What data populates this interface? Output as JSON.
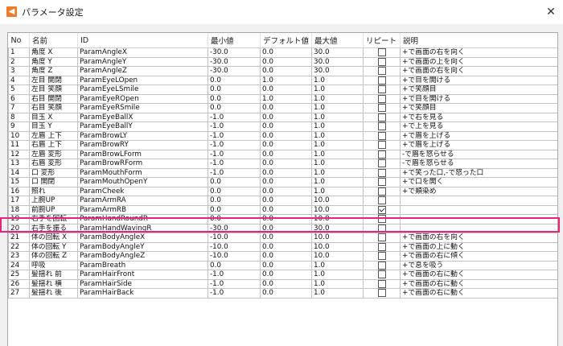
{
  "window": {
    "title": "パラメータ設定",
    "close_glyph": "✕"
  },
  "table": {
    "headers": [
      "No",
      "名前",
      "ID",
      "最小値",
      "デフォルト値",
      "最大値",
      "リピート",
      "説明"
    ],
    "rows": [
      {
        "no": "1",
        "name": "角度 X",
        "id": "ParamAngleX",
        "min": "-30.0",
        "def": "0.0",
        "max": "30.0",
        "repeat": false,
        "desc": "+で画面の右を向く"
      },
      {
        "no": "2",
        "name": "角度 Y",
        "id": "ParamAngleY",
        "min": "-30.0",
        "def": "0.0",
        "max": "30.0",
        "repeat": false,
        "desc": "+で画面の上を向く"
      },
      {
        "no": "3",
        "name": "角度 Z",
        "id": "ParamAngleZ",
        "min": "-30.0",
        "def": "0.0",
        "max": "30.0",
        "repeat": false,
        "desc": "+で画面の右を向く"
      },
      {
        "no": "4",
        "name": "左目 開閉",
        "id": "ParamEyeLOpen",
        "min": "0.0",
        "def": "1.0",
        "max": "1.0",
        "repeat": false,
        "desc": "+で目を開ける"
      },
      {
        "no": "5",
        "name": "左目 笑顔",
        "id": "ParamEyeLSmile",
        "min": "0.0",
        "def": "0.0",
        "max": "1.0",
        "repeat": false,
        "desc": "+で笑顔目"
      },
      {
        "no": "6",
        "name": "右目 開閉",
        "id": "ParamEyeROpen",
        "min": "0.0",
        "def": "1.0",
        "max": "1.0",
        "repeat": false,
        "desc": "+で目を開ける"
      },
      {
        "no": "7",
        "name": "右目 笑顔",
        "id": "ParamEyeRSmile",
        "min": "0.0",
        "def": "0.0",
        "max": "1.0",
        "repeat": false,
        "desc": "+で笑顔目"
      },
      {
        "no": "8",
        "name": "目玉 X",
        "id": "ParamEyeBallX",
        "min": "-1.0",
        "def": "0.0",
        "max": "1.0",
        "repeat": false,
        "desc": "+で右を見る"
      },
      {
        "no": "9",
        "name": "目玉 Y",
        "id": "ParamEyeBallY",
        "min": "-1.0",
        "def": "0.0",
        "max": "1.0",
        "repeat": false,
        "desc": "+で上を見る"
      },
      {
        "no": "10",
        "name": "左眉 上下",
        "id": "ParamBrowLY",
        "min": "-1.0",
        "def": "0.0",
        "max": "1.0",
        "repeat": false,
        "desc": "+で眉を上げる"
      },
      {
        "no": "11",
        "name": "右眉 上下",
        "id": "ParamBrowRY",
        "min": "-1.0",
        "def": "0.0",
        "max": "1.0",
        "repeat": false,
        "desc": "+で眉を上げる"
      },
      {
        "no": "12",
        "name": "左眉 変形",
        "id": "ParamBrowLForm",
        "min": "-1.0",
        "def": "0.0",
        "max": "1.0",
        "repeat": false,
        "desc": "-で眉を怒らせる"
      },
      {
        "no": "13",
        "name": "右眉 変形",
        "id": "ParamBrowRForm",
        "min": "-1.0",
        "def": "0.0",
        "max": "1.0",
        "repeat": false,
        "desc": "-で眉を怒らせる"
      },
      {
        "no": "14",
        "name": "口 変形",
        "id": "ParamMouthForm",
        "min": "-1.0",
        "def": "0.0",
        "max": "1.0",
        "repeat": false,
        "desc": "+で笑った口,-で怒った口"
      },
      {
        "no": "15",
        "name": "口 開閉",
        "id": "ParamMouthOpenY",
        "min": "0.0",
        "def": "0.0",
        "max": "1.0",
        "repeat": false,
        "desc": "+で口を開く"
      },
      {
        "no": "16",
        "name": "照れ",
        "id": "ParamCheek",
        "min": "0.0",
        "def": "0.0",
        "max": "1.0",
        "repeat": false,
        "desc": "+で頬染め"
      },
      {
        "no": "17",
        "name": "上腕UP",
        "id": "ParamArmRA",
        "min": "0.0",
        "def": "0.0",
        "max": "10.0",
        "repeat": false,
        "desc": ""
      },
      {
        "no": "18",
        "name": "前腕UP",
        "id": "ParamArmRB",
        "min": "0.0",
        "def": "0.0",
        "max": "10.0",
        "repeat": true,
        "desc": ""
      },
      {
        "no": "19",
        "name": "右手を回転",
        "id": "ParamHandRoundR",
        "min": "0.0",
        "def": "0.0",
        "max": "10.0",
        "repeat": false,
        "desc": ""
      },
      {
        "no": "20",
        "name": "右手を振る",
        "id": "ParamHandWavingR",
        "min": "-30.0",
        "def": "0.0",
        "max": "30.0",
        "repeat": false,
        "desc": ""
      },
      {
        "no": "21",
        "name": "体の回転 X",
        "id": "ParamBodyAngleX",
        "min": "-10.0",
        "def": "0.0",
        "max": "10.0",
        "repeat": false,
        "desc": "+で画面の右を向く"
      },
      {
        "no": "22",
        "name": "体の回転 Y",
        "id": "ParamBodyAngleY",
        "min": "-10.0",
        "def": "0.0",
        "max": "10.0",
        "repeat": false,
        "desc": "+で画面の上に動く"
      },
      {
        "no": "23",
        "name": "体の回転 Z",
        "id": "ParamBodyAngleZ",
        "min": "-10.0",
        "def": "0.0",
        "max": "10.0",
        "repeat": false,
        "desc": "+で画面の右に傾く"
      },
      {
        "no": "24",
        "name": "呼吸",
        "id": "ParamBreath",
        "min": "0.0",
        "def": "0.0",
        "max": "1.0",
        "repeat": false,
        "desc": "+で息を吸う"
      },
      {
        "no": "25",
        "name": "髪揺れ 前",
        "id": "ParamHairFront",
        "min": "-1.0",
        "def": "0.0",
        "max": "1.0",
        "repeat": false,
        "desc": "+で画面の右に動く"
      },
      {
        "no": "26",
        "name": "髪揺れ 横",
        "id": "ParamHairSide",
        "min": "-1.0",
        "def": "0.0",
        "max": "1.0",
        "repeat": false,
        "desc": "+で画面の右に動く"
      },
      {
        "no": "27",
        "name": "髪揺れ 後",
        "id": "ParamHairBack",
        "min": "-1.0",
        "def": "0.0",
        "max": "1.0",
        "repeat": false,
        "desc": "+で画面の右に動く"
      }
    ],
    "highlighted_row_no": "18"
  },
  "colors": {
    "accent_icon": "#f07a28",
    "highlight_border": "#e8247a"
  },
  "icons": {
    "app": "app-icon",
    "close": "close-icon",
    "checkbox": "checkbox"
  }
}
